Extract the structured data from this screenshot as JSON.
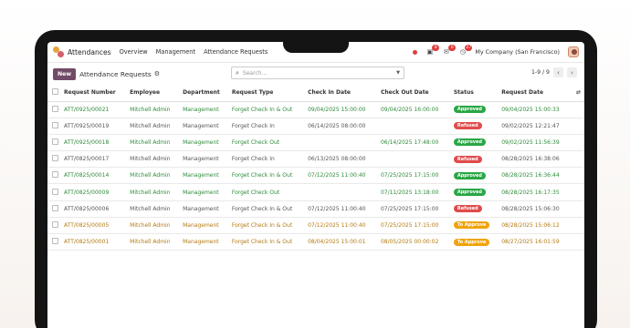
{
  "app": {
    "title": "Attendances",
    "menu": [
      "Overview",
      "Management",
      "Attendance Requests"
    ],
    "company": "My Company (San Francisco)",
    "badges": {
      "activity": "8",
      "messages": "6",
      "timer": "27"
    }
  },
  "control": {
    "new_label": "New",
    "title": "Attendance Requests",
    "search_placeholder": "Search...",
    "pager": "1-9 / 9"
  },
  "table": {
    "headers": [
      "Request Number",
      "Employee",
      "Department",
      "Request Type",
      "Check In Date",
      "Check Out Date",
      "Status",
      "Request Date"
    ],
    "rows": [
      {
        "tone": "green",
        "cells": [
          "ATT/0925/00021",
          "Mitchell Admin",
          "Management",
          "Forget Check In & Out",
          "09/04/2025 15:00:00",
          "09/04/2025 16:00:00",
          "Approved",
          "09/04/2025 15:00:33"
        ]
      },
      {
        "tone": "grey",
        "cells": [
          "ATT/0925/00019",
          "Mitchell Admin",
          "Management",
          "Forget Check In",
          "06/14/2025 08:00:00",
          "",
          "Refused",
          "09/02/2025 12:21:47"
        ]
      },
      {
        "tone": "green",
        "cells": [
          "ATT/0925/00018",
          "Mitchell Admin",
          "Management",
          "Forget Check Out",
          "",
          "06/14/2025 17:48:00",
          "Approved",
          "09/02/2025 11:56:39"
        ]
      },
      {
        "tone": "grey",
        "cells": [
          "ATT/0825/00017",
          "Mitchell Admin",
          "Management",
          "Forget Check In",
          "06/13/2025 08:00:00",
          "",
          "Refused",
          "08/28/2025 16:38:06"
        ]
      },
      {
        "tone": "green",
        "cells": [
          "ATT/0825/00014",
          "Mitchell Admin",
          "Management",
          "Forget Check In & Out",
          "07/12/2025 11:00:40",
          "07/25/2025 17:15:00",
          "Approved",
          "08/28/2025 16:36:44"
        ]
      },
      {
        "tone": "green",
        "cells": [
          "ATT/0825/00009",
          "Mitchell Admin",
          "Management",
          "Forget Check Out",
          "",
          "07/11/2025 13:18:00",
          "Approved",
          "08/28/2025 16:17:35"
        ]
      },
      {
        "tone": "grey",
        "cells": [
          "ATT/0825/00006",
          "Mitchell Admin",
          "Management",
          "Forget Check In & Out",
          "07/12/2025 11:00:40",
          "07/25/2025 17:15:00",
          "Refused",
          "08/28/2025 15:06:30"
        ]
      },
      {
        "tone": "orange",
        "cells": [
          "ATT/0825/00005",
          "Mitchell Admin",
          "Management",
          "Forget Check In & Out",
          "07/12/2025 11:00:40",
          "07/25/2025 17:15:00",
          "To Approve",
          "08/28/2025 15:06:12"
        ]
      },
      {
        "tone": "orange",
        "cells": [
          "ATT/0825/00001",
          "Mitchell Admin",
          "Management",
          "Forget Check In & Out",
          "08/04/2025 15:00:01",
          "08/05/2025 00:00:02",
          "To Approve",
          "08/27/2025 16:01:59"
        ]
      }
    ]
  },
  "colors": {
    "brand": "#714b67",
    "Approved": "#28a745",
    "Refused": "#e04b4b",
    "To Approve": "#f0a30a"
  }
}
